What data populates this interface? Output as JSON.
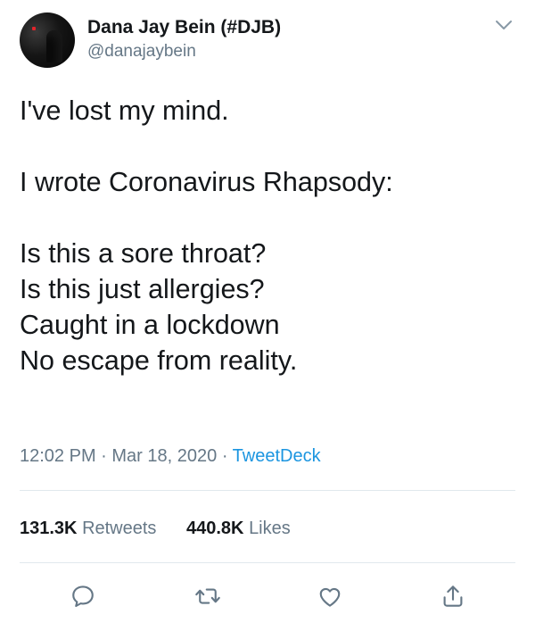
{
  "author": {
    "display_name": "Dana Jay Bein (#DJB)",
    "handle": "@danajaybein"
  },
  "tweet": {
    "lines": [
      "I've lost my mind.",
      "",
      "I wrote Coronavirus Rhapsody:",
      "",
      "Is this a sore throat?",
      "Is this just allergies?",
      "Caught in a lockdown",
      "No escape from reality."
    ],
    "time": "12:02 PM",
    "date": "Mar 18, 2020",
    "source": "TweetDeck"
  },
  "stats": {
    "retweets_count": "131.3K",
    "retweets_label": "Retweets",
    "likes_count": "440.8K",
    "likes_label": "Likes"
  },
  "icons": {
    "menu": "chevron-down-icon",
    "reply": "reply-icon",
    "retweet": "retweet-icon",
    "like": "heart-icon",
    "share": "share-icon"
  },
  "colors": {
    "text": "#14171a",
    "secondary": "#657786",
    "link": "#1b95e0",
    "divider": "#e1e8ed"
  }
}
